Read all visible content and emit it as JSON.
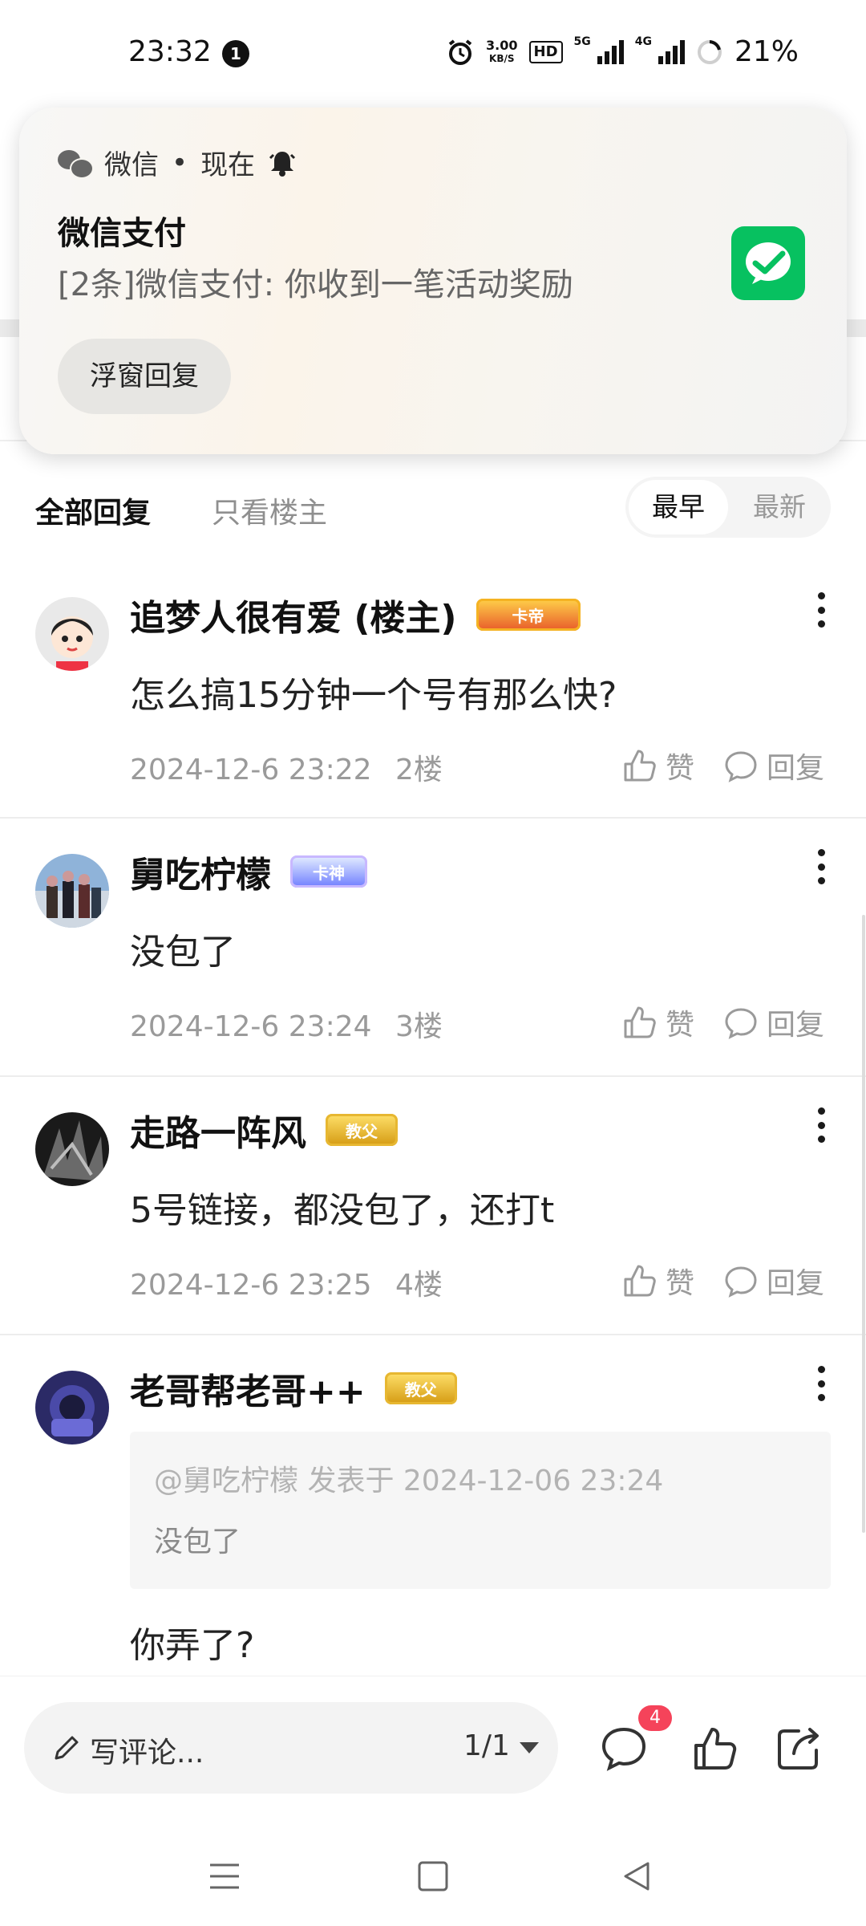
{
  "status_bar": {
    "time": "23:32",
    "notification_count": "1",
    "net_speed_value": "3.00",
    "net_speed_unit": "KB/S",
    "hd_label": "HD",
    "net_5g": "5G",
    "net_4g": "4G",
    "battery": "21%"
  },
  "notification": {
    "app_name": "微信",
    "time": "现在",
    "title": "微信支付",
    "body": "[2条]微信支付: 你收到一笔活动奖励",
    "reply_button": "浮窗回复",
    "icon_color": "#07c160"
  },
  "filter": {
    "all_replies": "全部回复",
    "only_op": "只看楼主",
    "sort_earliest": "最早",
    "sort_latest": "最新"
  },
  "comments": [
    {
      "username": "追梦人很有爱 (楼主)",
      "badge": "卡帝",
      "text": "怎么搞15分钟一个号有那么快?",
      "datetime": "2024-12-6 23:22",
      "floor": "2楼",
      "like_label": "赞",
      "reply_label": "回复"
    },
    {
      "username": "舅吃柠檬",
      "badge": "卡神",
      "text": "没包了",
      "datetime": "2024-12-6 23:24",
      "floor": "3楼",
      "like_label": "赞",
      "reply_label": "回复"
    },
    {
      "username": "走路一阵风",
      "badge": "教父",
      "text": "5号链接，都没包了，还打t",
      "datetime": "2024-12-6 23:25",
      "floor": "4楼",
      "like_label": "赞",
      "reply_label": "回复"
    },
    {
      "username": "老哥帮老哥++",
      "badge": "教父",
      "quote_ref": "@舅吃柠檬 发表于 2024-12-06 23:24",
      "quote_text": "没包了",
      "text": "你弄了?"
    }
  ],
  "bottom_bar": {
    "write_comment_placeholder": "写评论...",
    "page_indicator": "1/1",
    "comment_count": "4",
    "badge_color": "#f5435a"
  },
  "icons": {
    "comment": "speech-bubble-icon",
    "like": "thumb-up-icon",
    "share": "share-icon",
    "nav_menu": "menu-icon",
    "nav_home": "square-home-icon",
    "nav_back": "triangle-back-icon"
  }
}
